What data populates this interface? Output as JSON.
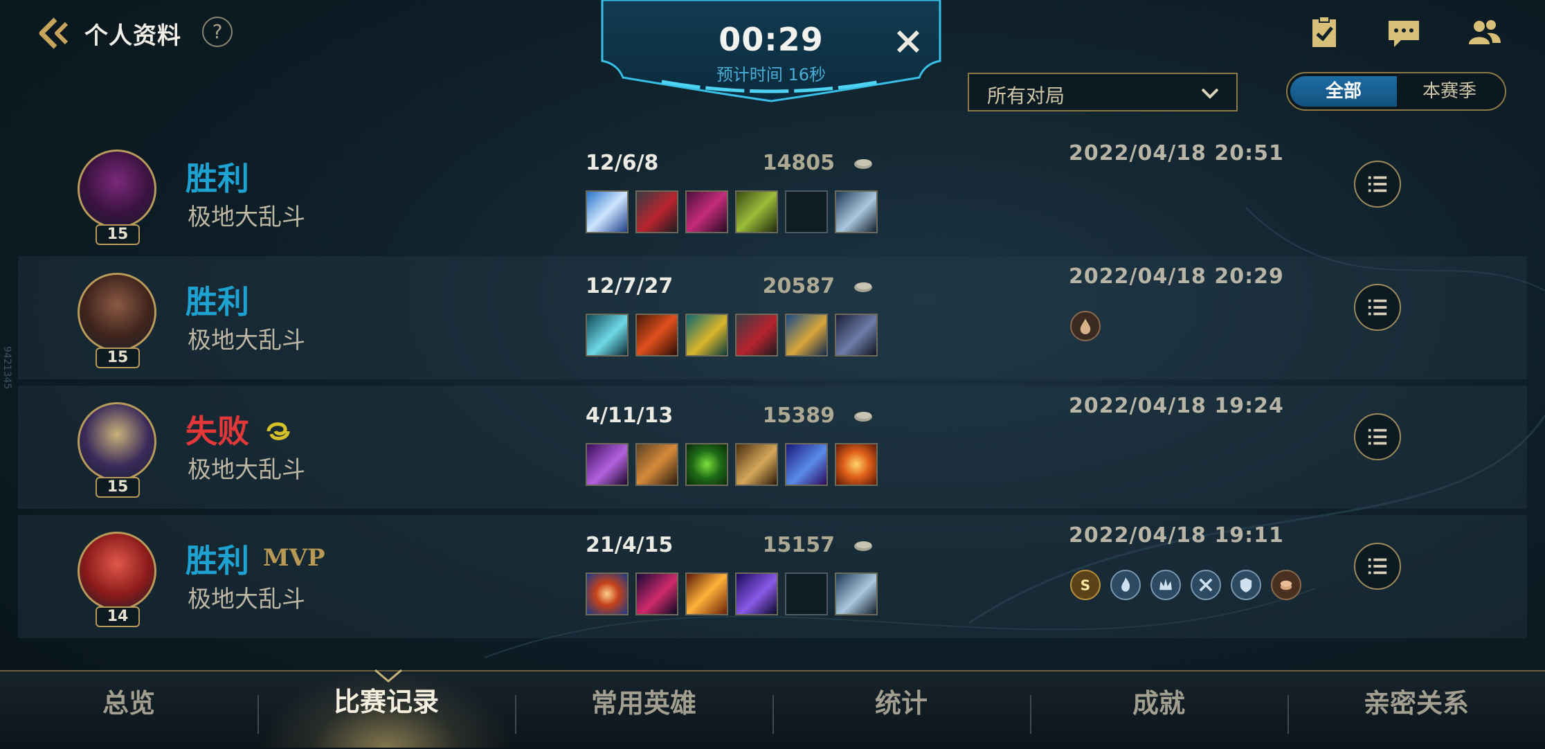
{
  "header": {
    "title": "个人资料",
    "help_label": "?"
  },
  "queue": {
    "time": "00:29",
    "estimate": "预计时间 16秒"
  },
  "filters": {
    "select_value": "所有对局",
    "segment_all": "全部",
    "segment_season": "本赛季",
    "active_segment": "全部"
  },
  "matches": [
    {
      "result": "胜利",
      "outcome": "win",
      "mode": "极地大乱斗",
      "level": "15",
      "kda": "12/6/8",
      "gold": "14805",
      "date": "2022/04/18 20:51",
      "mvp": "",
      "items": [
        "ice-blade",
        "dark-hammer",
        "purple-scythe",
        "green-crossbow",
        "",
        "ward-totem"
      ]
    },
    {
      "result": "胜利",
      "outcome": "win",
      "mode": "极地大乱斗",
      "level": "15",
      "kda": "12/7/27",
      "gold": "20587",
      "date": "2022/04/18 20:29",
      "mvp": "",
      "items": [
        "frost-cloak",
        "flame-blade",
        "serpent-staff",
        "dark-hammer",
        "golden-pick",
        "shadow-ward"
      ],
      "medals": [
        "bronze-drop-medal"
      ]
    },
    {
      "result": "失败",
      "outcome": "loss",
      "mode": "极地大乱斗",
      "level": "15",
      "kda": "4/11/13",
      "gold": "15389",
      "date": "2022/04/18 19:24",
      "mvp": "",
      "flag_icon": "yellow-swirl-icon",
      "items": [
        "void-staff",
        "armor-chest",
        "green-skull-orb",
        "gold-gauntlet",
        "crystal-tome",
        "fire-burst"
      ]
    },
    {
      "result": "胜利",
      "outcome": "win",
      "mode": "极地大乱斗",
      "level": "14",
      "kda": "21/4/15",
      "gold": "15157",
      "date": "2022/04/18 19:11",
      "mvp": "MVP",
      "items": [
        "target-orb",
        "crimson-hood",
        "blazing-sword",
        "void-scepter",
        "",
        "ward-totem"
      ],
      "medals": [
        "gold-s-medal",
        "blue-flame-medal",
        "blue-crown-medal",
        "blue-sword-medal",
        "blue-shield-medal",
        "bronze-coin-medal"
      ]
    }
  ],
  "tabs": [
    "总览",
    "比赛记录",
    "常用英雄",
    "统计",
    "成就",
    "亲密关系"
  ],
  "active_tab": "比赛记录",
  "side_tag": "9421345",
  "colors": {
    "win": "#1ea2d1",
    "loss": "#e2383a",
    "gold_trim": "#b89b5b",
    "active_segment": "#1d6ca3"
  }
}
